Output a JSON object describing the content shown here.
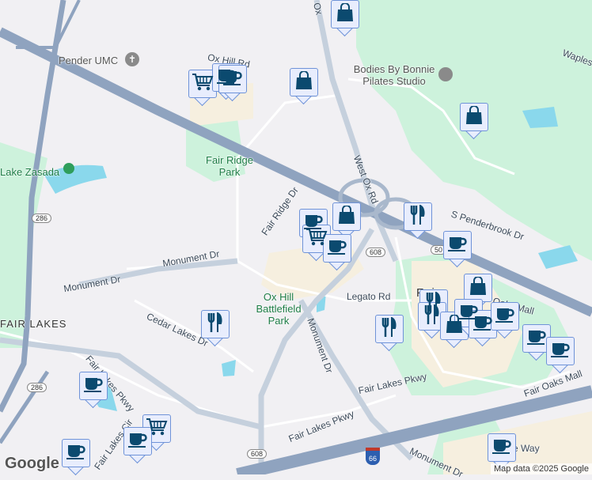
{
  "map": {
    "roads": [
      "Ox Hill Rd",
      "West Ox Rd",
      "Fair Ridge Dr",
      "S Penderbrook Dr",
      "Monument Dr",
      "Monument Dr",
      "Monument Dr",
      "Monument Dr",
      "Cedar Lakes Dr",
      "Legato Rd",
      "Fair Lakes Pkwy",
      "Fair Lakes Pkwy",
      "Fair Lakes Pkwy",
      "Fair Lakes Cir",
      "Fair Oaks Mall",
      "Oaks Mall",
      "Waples",
      "e Way",
      "Ox"
    ],
    "parks": [
      "Fair Ridge Park",
      "Ox Hill Battlefield Park",
      "Lake Zasada"
    ],
    "areas": [
      "FAIR LAKES",
      "Fair"
    ],
    "pois": [
      "Pender UMC",
      "Bodies By Bonnie Pilates Studio"
    ],
    "route_shields": [
      "286",
      "286",
      "50",
      "608",
      "608",
      "66"
    ],
    "markers": [
      "bag",
      "cart",
      "cup",
      "cup",
      "bag",
      "bag",
      "cup",
      "bag",
      "cart",
      "cup",
      "fork",
      "cup",
      "bag",
      "fork",
      "fork",
      "bag",
      "cup",
      "cup",
      "cup",
      "cup",
      "fork",
      "fork",
      "cup",
      "cup",
      "cart",
      "cup",
      "cup"
    ]
  },
  "footer": {
    "logo": "Google",
    "attribution": "Map data ©2025 Google"
  },
  "colors": {
    "road_highway": "#8fa3bf",
    "park": "#cdf2dc",
    "commercial": "#f6efdf",
    "water": "#8ad8ec",
    "marker_icon": "#0b4a6f"
  }
}
